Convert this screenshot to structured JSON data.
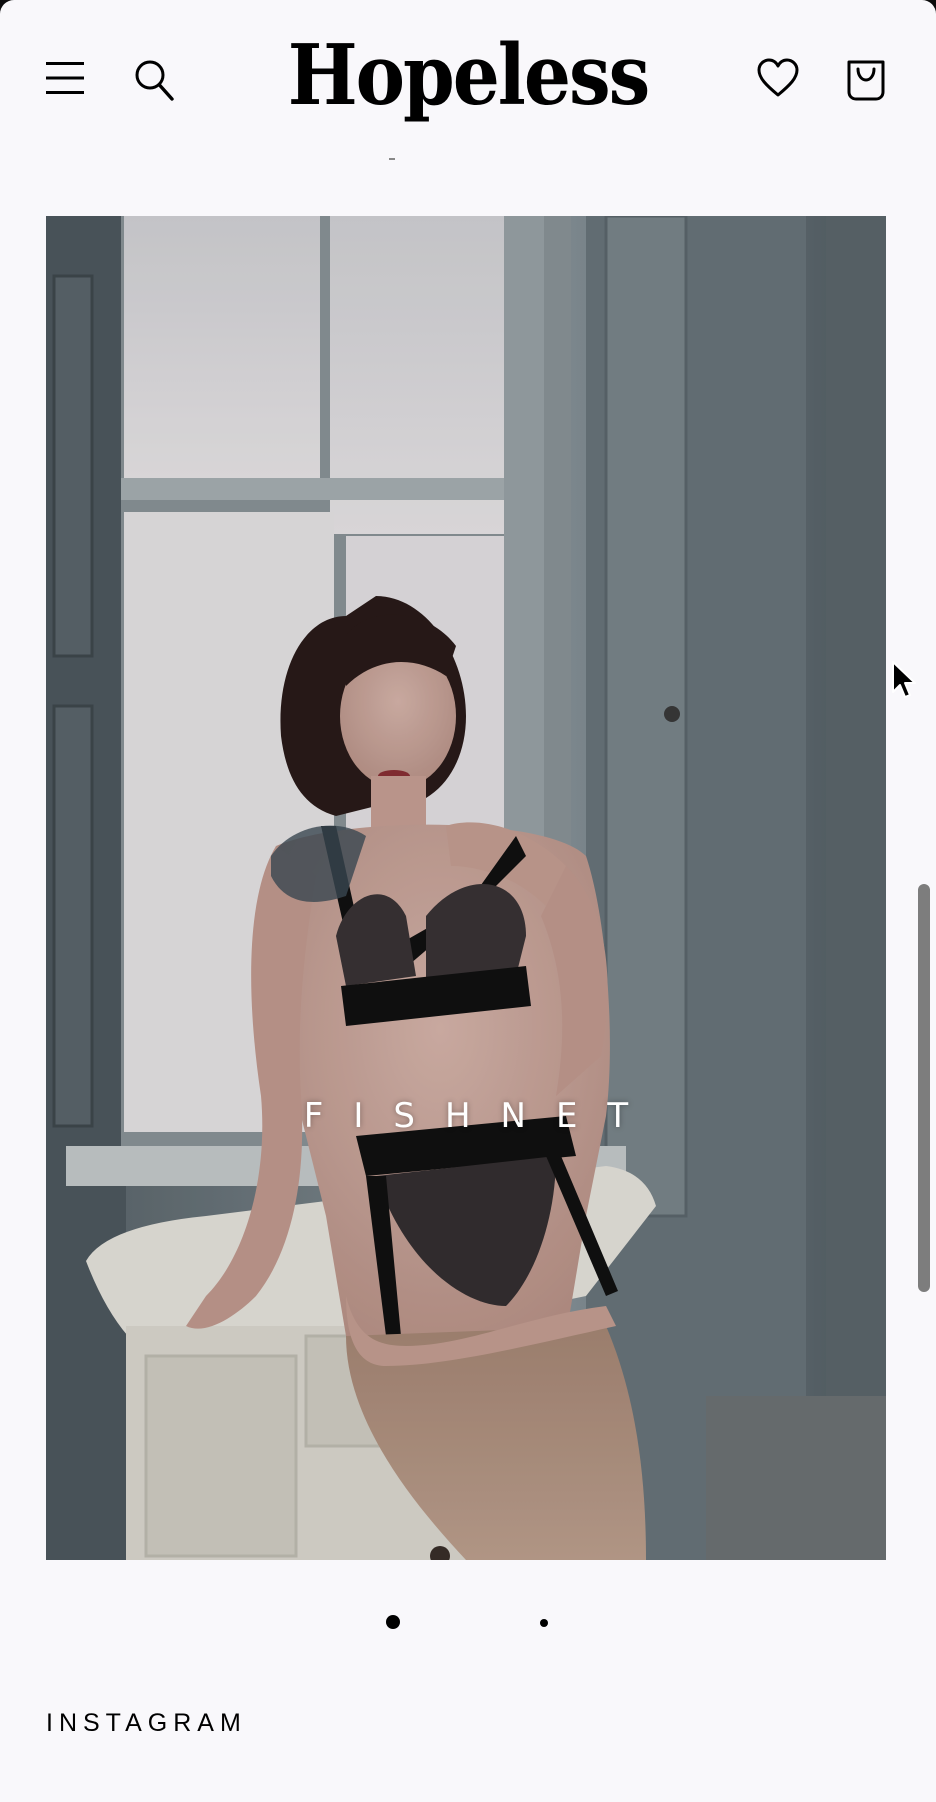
{
  "header": {
    "logo_text": "Hopeless",
    "menu_icon": "hamburger-menu-icon",
    "search_icon": "search-icon",
    "wishlist_icon": "heart-icon",
    "cart_icon": "shopping-bag-icon"
  },
  "banner": {
    "title": "FISHNET",
    "image_description_icon": "photo"
  },
  "slider": {
    "total_slides": 2,
    "active_slide": 1
  },
  "instagram": {
    "heading": "INSTAGRAM"
  },
  "colors": {
    "page_background": "#f9f8fb",
    "text": "#000000",
    "banner_title": "#ffffff"
  }
}
